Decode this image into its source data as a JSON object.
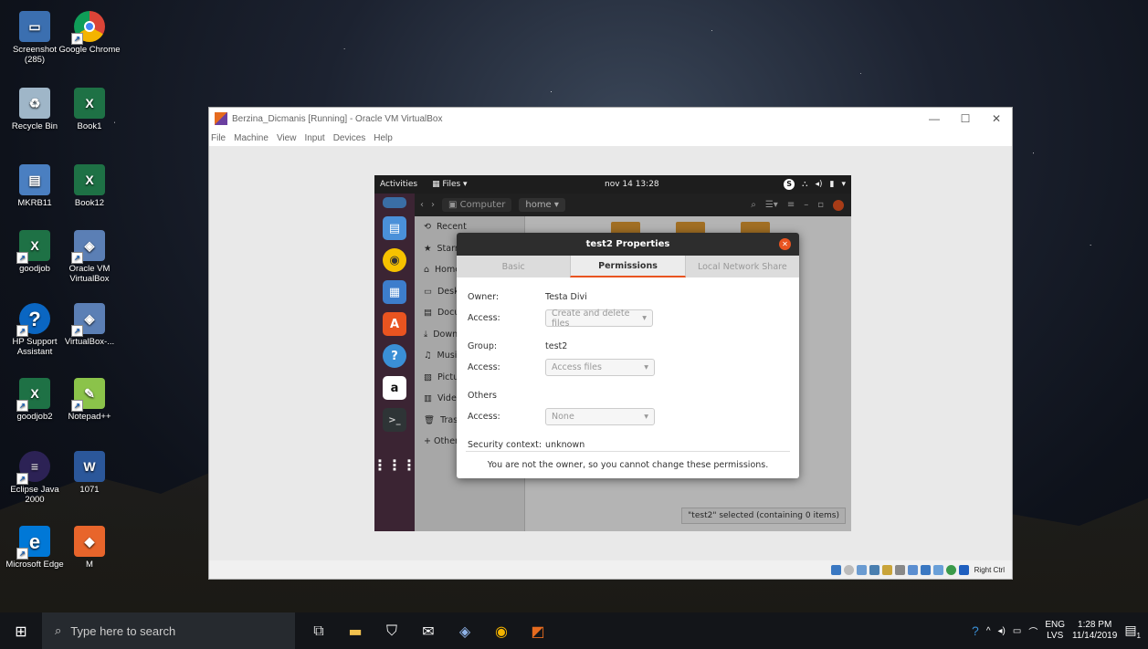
{
  "desktop": {
    "icons": [
      {
        "label": "Screenshot (285)",
        "name": "desktop-icon-screenshot"
      },
      {
        "label": "Google Chrome",
        "name": "desktop-icon-chrome"
      },
      {
        "label": "Recycle Bin",
        "name": "desktop-icon-recycle-bin"
      },
      {
        "label": "Book1",
        "name": "desktop-icon-book1"
      },
      {
        "label": "MKRB11",
        "name": "desktop-icon-mkrb11"
      },
      {
        "label": "Book12",
        "name": "desktop-icon-book12"
      },
      {
        "label": "goodjob",
        "name": "desktop-icon-goodjob"
      },
      {
        "label": "Oracle VM VirtualBox",
        "name": "desktop-icon-oracle-vm-virtualbox"
      },
      {
        "label": "HP Support Assistant",
        "name": "desktop-icon-hp-support"
      },
      {
        "label": "VirtualBox-...",
        "name": "desktop-icon-virtualbox-shortcut"
      },
      {
        "label": "goodjob2",
        "name": "desktop-icon-goodjob2"
      },
      {
        "label": "Notepad++",
        "name": "desktop-icon-notepadpp"
      },
      {
        "label": "Eclipse Java 2000",
        "name": "desktop-icon-eclipse"
      },
      {
        "label": "1071",
        "name": "desktop-icon-1071"
      },
      {
        "label": "Microsoft Edge",
        "name": "desktop-icon-edge"
      },
      {
        "label": "M",
        "name": "desktop-icon-m"
      }
    ]
  },
  "vbox": {
    "title": "Berzina_Dicmanis [Running] - Oracle VM VirtualBox",
    "menu": [
      "File",
      "Machine",
      "View",
      "Input",
      "Devices",
      "Help"
    ],
    "host_key": "Right Ctrl",
    "controls": {
      "minimize": "—",
      "maximize": "☐",
      "close": "✕"
    }
  },
  "guest": {
    "topbar": {
      "activities": "Activities",
      "app": "▦ Files ▾",
      "clock": "nov 14  13:28"
    },
    "path": {
      "computer": "Computer",
      "home": "home ▾"
    },
    "sidebar": [
      "Recent",
      "Starred",
      "Home",
      "Desktop",
      "Documents",
      "Downloads",
      "Music",
      "Pictures",
      "Videos",
      "Trash",
      "+ Other Locations"
    ],
    "status": "\"test2\" selected  (containing 0 items)"
  },
  "dialog": {
    "title": "test2 Properties",
    "tabs": [
      "Basic",
      "Permissions",
      "Local Network Share"
    ],
    "owner_label": "Owner:",
    "owner_value": "Testa Divi",
    "access_label": "Access:",
    "owner_access": "Create and delete files",
    "group_label": "Group:",
    "group_value": "test2",
    "group_access": "Access files",
    "others_label": "Others",
    "others_access": "None",
    "security_label": "Security context:",
    "security_value": "unknown",
    "footer": "You are not the owner, so you cannot change these permissions."
  },
  "taskbar": {
    "search_placeholder": "Type here to search",
    "lang_top": "ENG",
    "lang_bottom": "LVS",
    "time": "1:28 PM",
    "date": "11/14/2019",
    "notifications": "1"
  },
  "colors": {
    "ubuntu_orange": "#e95420",
    "dock": "#3b2433",
    "taskbar": "#131519"
  }
}
